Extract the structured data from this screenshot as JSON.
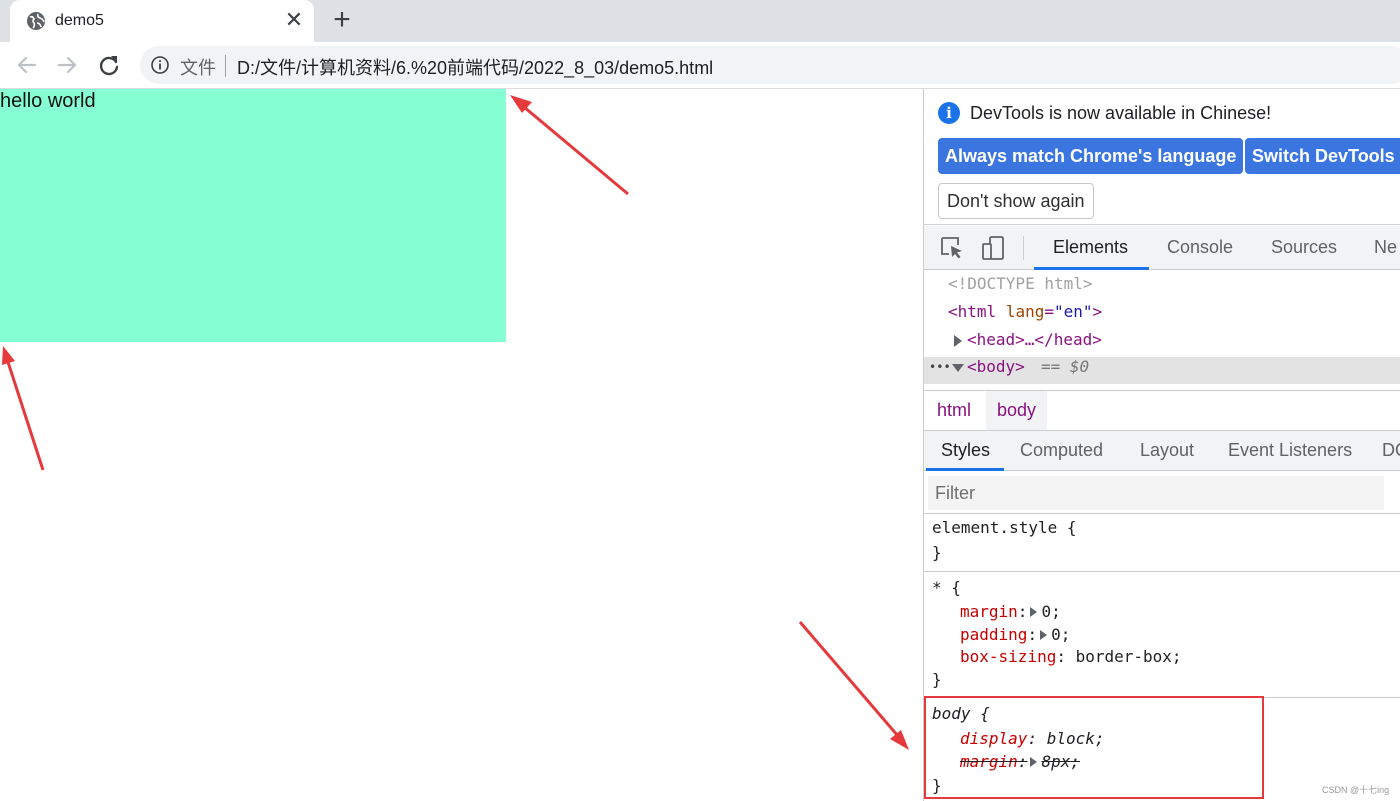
{
  "browser": {
    "tab": {
      "title": "demo5",
      "close_glyph": "✕",
      "icon": "globe-icon"
    },
    "new_tab_glyph": "+",
    "address": {
      "scheme_label": "文件",
      "url": "D:/文件/计算机资料/6.%20前端代码/2022_8_03/demo5.html"
    }
  },
  "page": {
    "box_text": "hello world",
    "box_color": "#87ffd5"
  },
  "devtools": {
    "infobar": {
      "message": "DevTools is now available in Chinese!",
      "btn_match": "Always match Chrome's language",
      "btn_switch": "Switch DevTools t",
      "btn_dismiss": "Don't show again"
    },
    "tabs": [
      "Elements",
      "Console",
      "Sources",
      "Ne"
    ],
    "dom": {
      "doctype": "<!DOCTYPE html>",
      "html_open_tag": "<html",
      "html_attr_name": "lang",
      "html_attr_eq": "=",
      "html_attr_value": "\"en\"",
      "html_close": ">",
      "head": "<head>…</head>",
      "body": "<body>",
      "body_suffix": "== $0",
      "dots": "•••"
    },
    "breadcrumbs": [
      "html",
      "body"
    ],
    "style_tabs": [
      "Styles",
      "Computed",
      "Layout",
      "Event Listeners",
      "DO"
    ],
    "filter_placeholder": "Filter",
    "rules": {
      "element_style": {
        "selector": "element.style {",
        "close": "}"
      },
      "universal": {
        "selector": "* {",
        "margin_prop": "margin",
        "margin_val": "0;",
        "padding_prop": "padding",
        "padding_val": "0;",
        "boxsizing_prop": "box-sizing",
        "boxsizing_val": "border-box;",
        "close": "}"
      },
      "body": {
        "selector": "body {",
        "display_prop": "display",
        "display_val": "block;",
        "margin_prop": "margin",
        "margin_val": "8px;",
        "close": "}"
      }
    }
  },
  "watermark": "CSDN @十七ing",
  "colors": {
    "accent": "#1a73e8",
    "annotation": "#e5393b"
  }
}
